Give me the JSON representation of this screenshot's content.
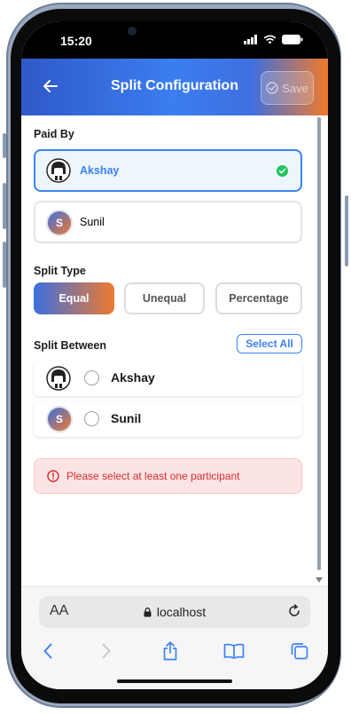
{
  "status_bar": {
    "time": "15:20"
  },
  "header": {
    "title": "Split Configuration",
    "save_label": "Save"
  },
  "paid_by": {
    "label": "Paid By",
    "options": [
      {
        "name": "Akshay",
        "avatar": "",
        "selected": true
      },
      {
        "name": "Sunil",
        "avatar": "S",
        "selected": false
      }
    ]
  },
  "split_type": {
    "label": "Split Type",
    "options": [
      {
        "label": "Equal",
        "active": true
      },
      {
        "label": "Unequal",
        "active": false
      },
      {
        "label": "Percentage",
        "active": false
      }
    ]
  },
  "split_between": {
    "label": "Split Between",
    "select_all_label": "Select All",
    "participants": [
      {
        "name": "Akshay",
        "avatar": "",
        "checked": false
      },
      {
        "name": "Sunil",
        "avatar": "S",
        "checked": false
      }
    ]
  },
  "error": {
    "message": "Please select at least one participant"
  },
  "browser": {
    "text_size_label": "AA",
    "url": "localhost"
  },
  "colors": {
    "accent_blue": "#3b82f6",
    "accent_orange": "#ef7a2e",
    "error_red": "#d62d2d"
  }
}
